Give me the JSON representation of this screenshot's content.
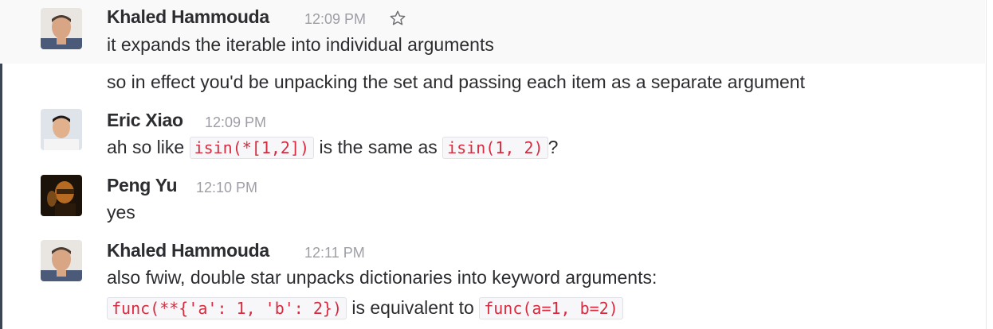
{
  "messages": [
    {
      "sender": "Khaled Hammouda",
      "time": "12:09 PM",
      "lines": [
        "it expands the iterable into individual arguments"
      ],
      "continuation": "so in effect you'd be unpacking the set and passing each item as a separate argument"
    },
    {
      "sender": "Eric Xiao",
      "time": "12:09 PM",
      "parts": {
        "t1": "ah so like ",
        "c1": "isin(*[1,2])",
        "t2": " is the same as ",
        "c2": "isin(1, 2)",
        "t3": "?"
      }
    },
    {
      "sender": "Peng Yu",
      "time": "12:10 PM",
      "text": "yes"
    },
    {
      "sender": "Khaled Hammouda",
      "time": "12:11 PM",
      "line1": "also fwiw, double star unpacks dictionaries into keyword arguments:",
      "parts": {
        "c1": "func(**{'a': 1, 'b': 2})",
        "t1": " is equivalent to ",
        "c2": "func(a=1, b=2)"
      }
    }
  ],
  "icons": {
    "star": "star-icon"
  },
  "colors": {
    "code_text": "#d72b3f",
    "timestamp": "#9e9ea6",
    "hover_bg": "#f9f9f9"
  }
}
